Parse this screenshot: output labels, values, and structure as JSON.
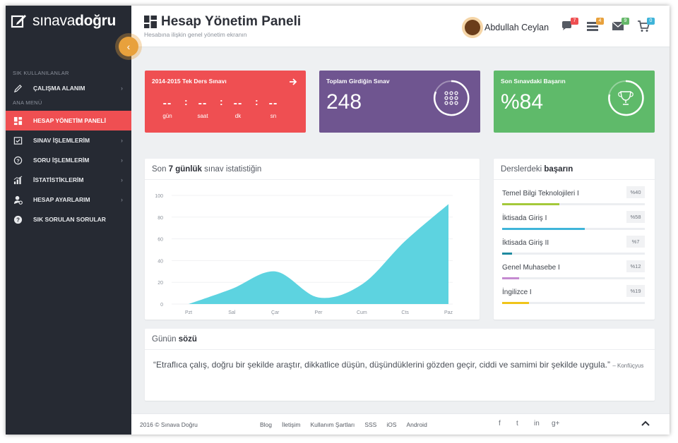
{
  "sidebar": {
    "logo": {
      "part1": "sınava",
      "part2": "doğru"
    },
    "sections": {
      "frequent": "SIK KULLANILANLAR",
      "main": "ANA MENÜ"
    },
    "items": [
      {
        "label": "ÇALIŞMA ALANIM",
        "icon": "pencil-icon"
      },
      {
        "label": "HESAP YÖNETİM PANELİ",
        "icon": "dashboard-icon",
        "active": true
      },
      {
        "label": "SINAV İŞLEMLERİM",
        "icon": "exam-icon"
      },
      {
        "label": "SORU İŞLEMLERİM",
        "icon": "question-icon"
      },
      {
        "label": "İSTATİSTİKLERİM",
        "icon": "stats-icon"
      },
      {
        "label": "HESAP AYARLARIM",
        "icon": "user-settings-icon"
      },
      {
        "label": "SIK SORULAN SORULAR",
        "icon": "faq-icon"
      }
    ]
  },
  "header": {
    "title": "Hesap Yönetim Paneli",
    "subtitle": "Hesabına ilişkin genel yönetim ekranın",
    "user_name": "Abdullah Ceylan",
    "badges": {
      "chat": "7",
      "list": "4",
      "mail": "9",
      "cart": "0"
    },
    "badge_colors": {
      "chat": "#ef4f52",
      "list": "#e8a13c",
      "mail": "#66b86a",
      "cart": "#3fb4d9"
    }
  },
  "cards": {
    "countdown": {
      "title": "2014-2015 Tek Ders Sınavı",
      "value": "--",
      "units": [
        "gün",
        "saat",
        "dk",
        "sn"
      ],
      "color": "#ef4f52"
    },
    "total": {
      "title": "Toplam Girdiğin Sınav",
      "value": "248",
      "color": "#6f5590"
    },
    "success": {
      "title": "Son Sınavdaki Başarın",
      "value": "%84",
      "color": "#5fba6a"
    }
  },
  "stats": {
    "title_pre": "Son ",
    "title_bold": "7 günlük",
    "title_post": " sınav istatistiğin"
  },
  "chart_data": {
    "type": "area",
    "categories": [
      "Pzt",
      "Sal",
      "Çar",
      "Per",
      "Cum",
      "Cts",
      "Paz"
    ],
    "values": [
      0,
      14,
      30,
      6,
      18,
      58,
      92
    ],
    "ylim": [
      0,
      100
    ],
    "yticks": [
      0,
      20,
      40,
      60,
      80,
      100
    ],
    "color": "#5dd3e0",
    "grid": true
  },
  "courses": {
    "title_pre": "Derslerdeki ",
    "title_bold": "başarın",
    "items": [
      {
        "name": "Temel Bilgi Teknolojileri I",
        "pct": "%40",
        "value": 0.4,
        "color": "#a4c93a"
      },
      {
        "name": "İktisada Giriş I",
        "pct": "%58",
        "value": 0.58,
        "color": "#3fb4d9"
      },
      {
        "name": "İktisada Giriş II",
        "pct": "%7",
        "value": 0.07,
        "color": "#1e8aa0"
      },
      {
        "name": "Genel Muhasebe I",
        "pct": "%12",
        "value": 0.12,
        "color": "#c58ad1"
      },
      {
        "name": "İngilizce I",
        "pct": "%19",
        "value": 0.19,
        "color": "#f0c419"
      }
    ]
  },
  "quote": {
    "title_pre": "Günün ",
    "title_bold": "sözü",
    "text": "“Etraflıca çalış, doğru bir şekilde araştır, dikkatlice düşün, düşündüklerini gözden geçir, ciddi ve samimi bir şekilde uygula.”",
    "author": "– Konfüçyus"
  },
  "footer": {
    "copyright": "2016 © Sınava Doğru",
    "links": [
      "Blog",
      "İletişim",
      "Kullanım Şartları",
      "SSS",
      "iOS",
      "Android"
    ],
    "social": [
      "f",
      "t",
      "in",
      "g+"
    ]
  }
}
